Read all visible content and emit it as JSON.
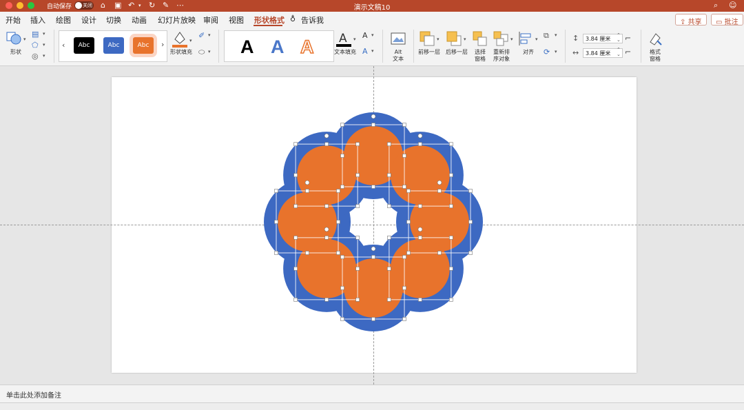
{
  "window": {
    "title": "演示文稿10",
    "autosave_label": "自动保存",
    "autosave_state": "关闭"
  },
  "tabs": [
    {
      "label": "开始"
    },
    {
      "label": "插入"
    },
    {
      "label": "绘图"
    },
    {
      "label": "设计"
    },
    {
      "label": "切换"
    },
    {
      "label": "动画"
    },
    {
      "label": "幻灯片放映"
    },
    {
      "label": "审阅"
    },
    {
      "label": "视图"
    },
    {
      "label": "形状格式",
      "active": true
    },
    {
      "label": "告诉我"
    }
  ],
  "header_buttons": {
    "share": "共享",
    "comments": "批注"
  },
  "ribbon": {
    "shapes_label": "形状",
    "style_swatch_text": "Abc",
    "shape_fill_label": "形状填充",
    "wordart_letter": "A",
    "text_fill_label": "文本填充",
    "alt_text_line1": "Alt",
    "alt_text_line2": "文本",
    "bring_forward": "前移一层",
    "send_backward": "后移一层",
    "selection_pane_line1": "选择",
    "selection_pane_line2": "窗格",
    "reorder_line1": "重新排",
    "reorder_line2": "序对象",
    "align": "对齐",
    "height_value": "3.84 厘米",
    "width_value": "3.84 厘米",
    "format_pane_line1": "格式",
    "format_pane_line2": "窗格"
  },
  "colors": {
    "accent": "#b7472a",
    "shape_blue": "#3d69c2",
    "shape_orange": "#e8732c"
  },
  "notes": {
    "placeholder": "单击此处添加备注"
  }
}
